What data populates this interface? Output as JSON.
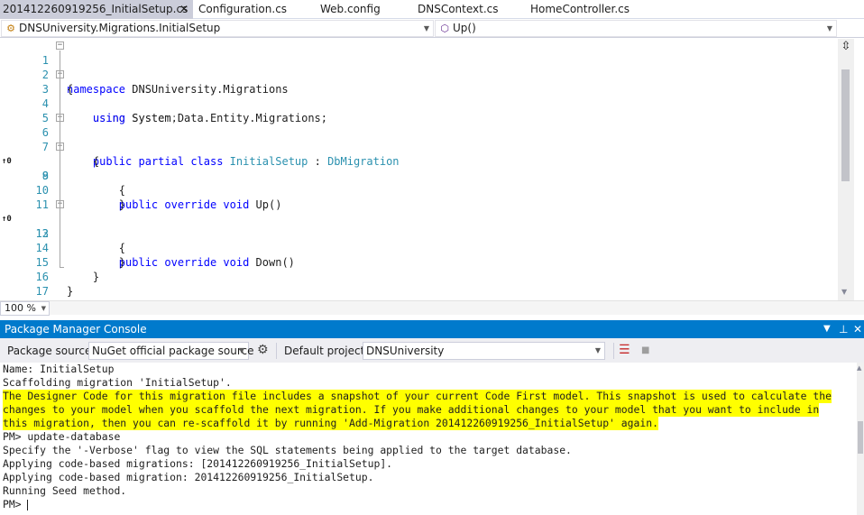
{
  "tabs": [
    {
      "label": "201412260919256_InitialSetup.cs",
      "active": true,
      "close": "✕"
    },
    {
      "label": "Configuration.cs"
    },
    {
      "label": "Web.config"
    },
    {
      "label": "DNSContext.cs"
    },
    {
      "label": "HomeController.cs"
    }
  ],
  "navbar": {
    "type_dropdown": "DNSUniversity.Migrations.InitialSetup",
    "member_dropdown": "Up()"
  },
  "editor": {
    "lines": [
      {
        "num": "1",
        "code": "namespace DNSUniversity.Migrations"
      },
      {
        "num": "2",
        "code": "{"
      },
      {
        "num": "3",
        "code": "    using System;"
      },
      {
        "num": "4",
        "code": "    using System.Data.Entity.Migrations;"
      },
      {
        "num": "5",
        "code": ""
      },
      {
        "num": "6",
        "code": "    public partial class InitialSetup : DbMigration"
      },
      {
        "num": "7",
        "code": "    {"
      },
      {
        "num": "8",
        "code": "        public override void Up()"
      },
      {
        "num": "9",
        "code": "        {"
      },
      {
        "num": "10",
        "code": "        }"
      },
      {
        "num": "11",
        "code": ""
      },
      {
        "num": "12",
        "code": "        public override void Down()"
      },
      {
        "num": "13",
        "code": "        {"
      },
      {
        "num": "14",
        "code": "        }"
      },
      {
        "num": "15",
        "code": "    }"
      },
      {
        "num": "16",
        "code": "}"
      },
      {
        "num": "17",
        "code": ""
      }
    ],
    "glyph_label": "↑0",
    "zoom": "100 %"
  },
  "console": {
    "title": "Package Manager Console",
    "package_source_label": "Package source:",
    "package_source": "NuGet official package source",
    "default_project_label": "Default project:",
    "default_project": "DNSUniversity",
    "output": [
      {
        "text": "Name: InitialSetup",
        "highlight": false
      },
      {
        "text": "Scaffolding migration 'InitialSetup'.",
        "highlight": false
      },
      {
        "text": "The Designer Code for this migration file includes a snapshot of your current Code First model. This snapshot is used to calculate the",
        "highlight": true
      },
      {
        "text": "changes to your model when you scaffold the next migration. If you make additional changes to your model that you want to include in",
        "highlight": true
      },
      {
        "text": "this migration, then you can re-scaffold it by running 'Add-Migration 201412260919256_InitialSetup' again.",
        "highlight": true
      },
      {
        "text": "PM> update-database",
        "highlight": false
      },
      {
        "text": "Specify the '-Verbose' flag to view the SQL statements being applied to the target database.",
        "highlight": false
      },
      {
        "text": "Applying code-based migrations: [201412260919256_InitialSetup].",
        "highlight": false
      },
      {
        "text": "Applying code-based migration: 201412260919256_InitialSetup.",
        "highlight": false
      },
      {
        "text": "Running Seed method.",
        "highlight": false
      }
    ],
    "prompt": "PM> "
  },
  "colors": {
    "keyword": "#0000ff",
    "type": "#2b91af",
    "directive": "#808080",
    "title_bar": "#007acc",
    "highlight": "#ffff00"
  }
}
